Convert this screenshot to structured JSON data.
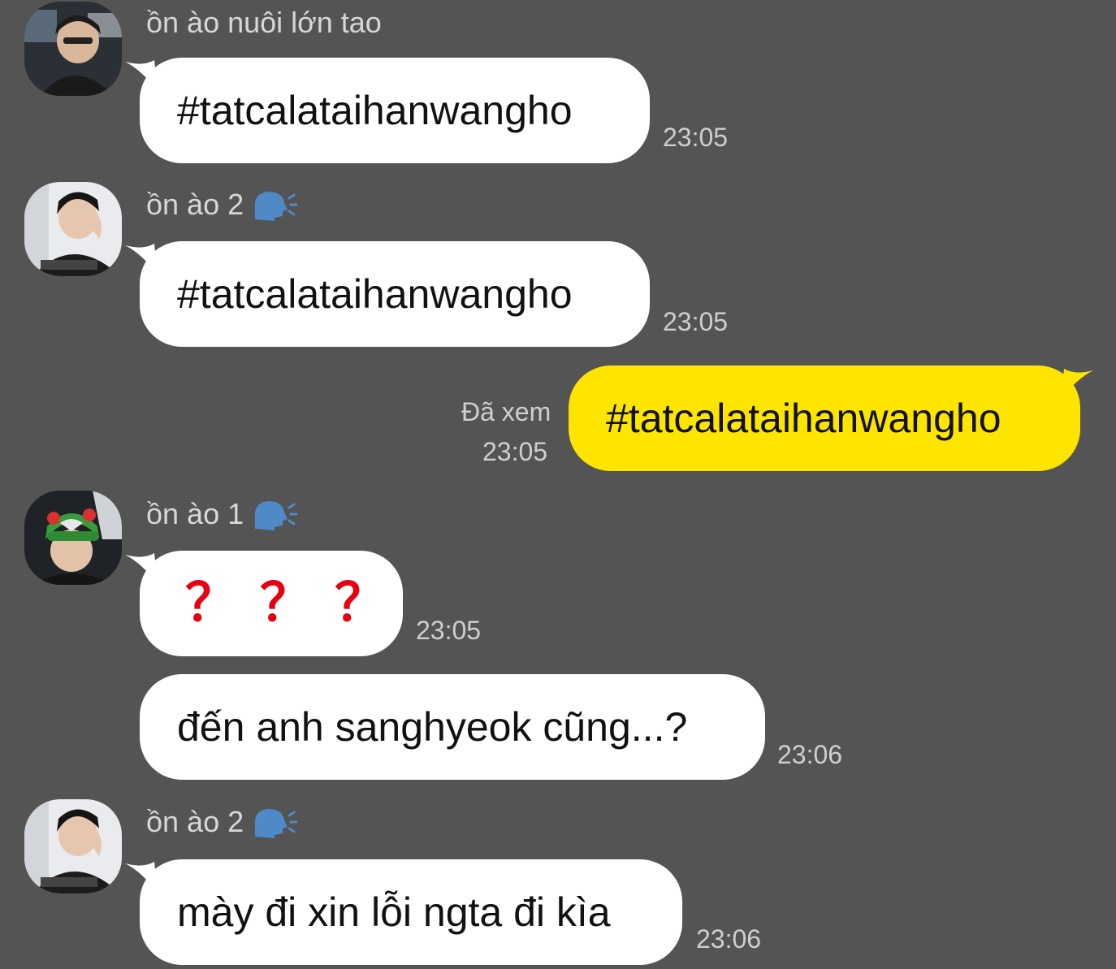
{
  "messages": [
    {
      "sender": "ồn ào nuôi lớn tao",
      "text": "#tatcalataihanwangho",
      "time": "23:05"
    },
    {
      "sender": "ồn ào 2",
      "sender_emoji": "speaking-head-emoji",
      "text": "#tatcalataihanwangho",
      "time": "23:05"
    },
    {
      "mine": true,
      "read_label": "Đã xem",
      "text": "#tatcalataihanwangho",
      "time": "23:05"
    },
    {
      "sender": "ồn ào 1",
      "sender_emoji": "speaking-head-emoji",
      "text": "？？？",
      "time": "23:05"
    },
    {
      "text": "đến anh sanghyeok cũng...?",
      "time": "23:06"
    },
    {
      "sender": "ồn ào 2",
      "sender_emoji": "speaking-head-emoji",
      "text": "mày đi xin lỗi ngta đi kìa",
      "time": "23:06"
    }
  ],
  "colors": {
    "background": "#545454",
    "incoming_bubble": "#ffffff",
    "outgoing_bubble": "#fee500",
    "question_marks": "#e60012",
    "meta_text": "#cfcfcf"
  }
}
